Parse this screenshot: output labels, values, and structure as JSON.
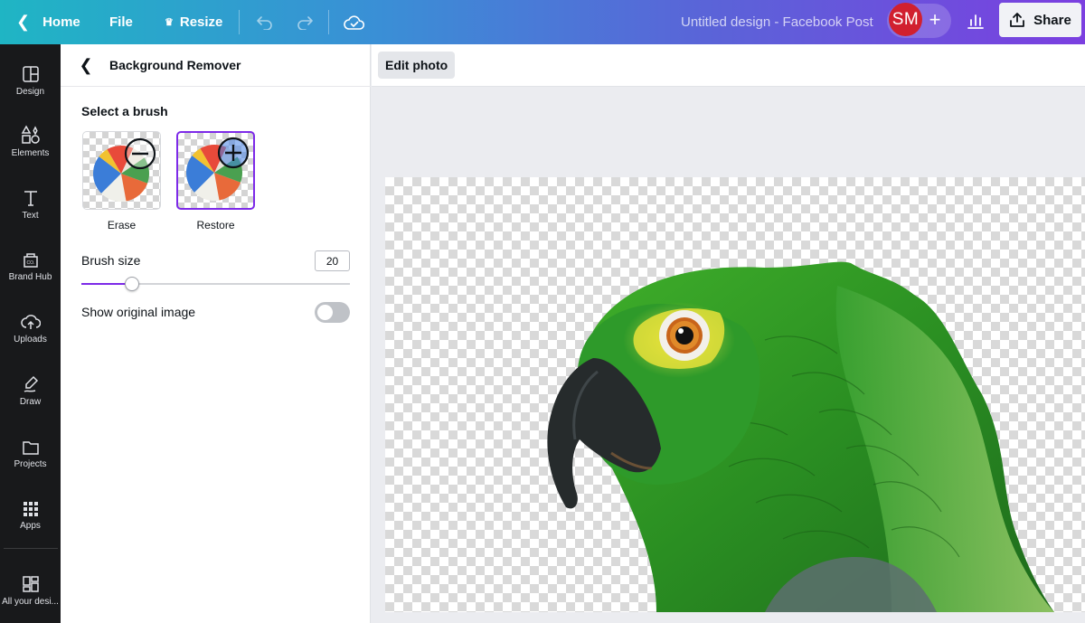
{
  "topbar": {
    "home_label": "Home",
    "file_label": "File",
    "resize_label": "Resize",
    "title": "Untitled design - Facebook Post",
    "avatar_initials": "SM",
    "share_label": "Share",
    "colors": {
      "gradient_start": "#1fb5c4",
      "gradient_end": "#7b3fe0",
      "avatar_bg": "#d1202f"
    }
  },
  "rail": {
    "items": [
      {
        "label": "Design",
        "icon": "design-icon"
      },
      {
        "label": "Elements",
        "icon": "elements-icon"
      },
      {
        "label": "Text",
        "icon": "text-icon"
      },
      {
        "label": "Brand Hub",
        "icon": "brand-hub-icon"
      },
      {
        "label": "Uploads",
        "icon": "uploads-icon"
      },
      {
        "label": "Draw",
        "icon": "draw-icon"
      },
      {
        "label": "Projects",
        "icon": "projects-icon"
      },
      {
        "label": "Apps",
        "icon": "apps-icon"
      },
      {
        "label": "All your desi...",
        "icon": "all-designs-icon"
      }
    ]
  },
  "panel": {
    "title": "Background Remover",
    "select_brush_label": "Select a brush",
    "brushes": [
      {
        "label": "Erase",
        "selected": false
      },
      {
        "label": "Restore",
        "selected": true
      }
    ],
    "brush_size_label": "Brush size",
    "brush_size_value": "20",
    "brush_size_fraction": 0.19,
    "show_original_label": "Show original image",
    "show_original_on": false,
    "accent": "#7d2ae8"
  },
  "context_toolbar": {
    "edit_photo_label": "Edit photo"
  }
}
